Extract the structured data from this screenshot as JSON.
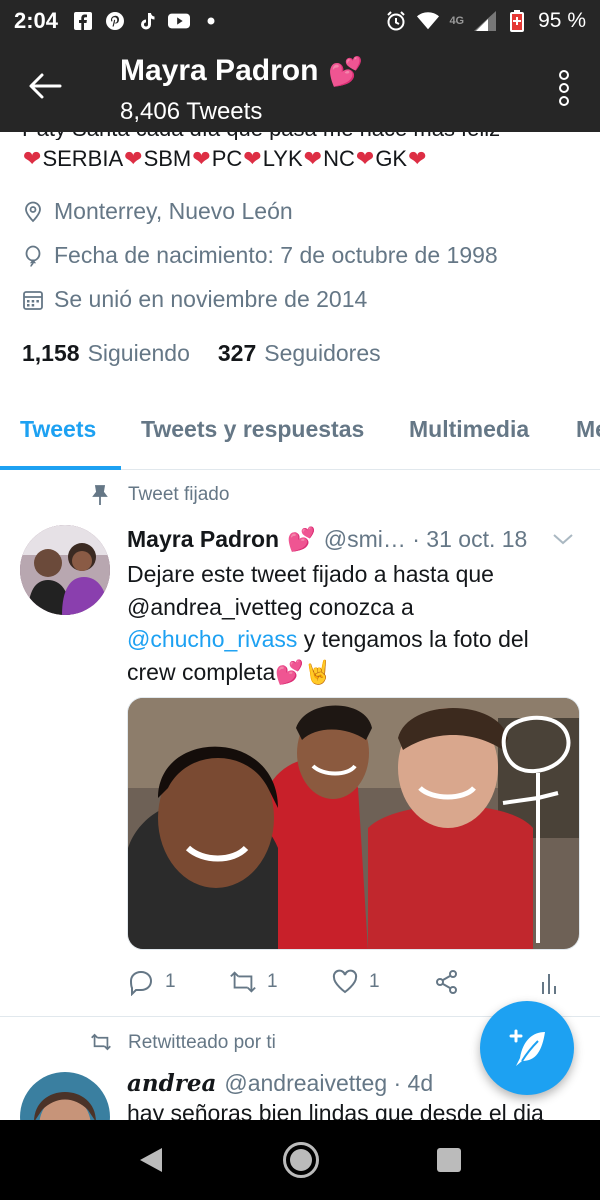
{
  "status_bar": {
    "time": "2:04",
    "battery_percent": "95 %",
    "network": "4G"
  },
  "header": {
    "back_icon": "arrow-left-icon",
    "title": "Mayra Padron",
    "title_emoji": "💕",
    "tweet_count": "8,406 Tweets"
  },
  "profile": {
    "bio_partial": "Paty Santa cada día que pasa me hace más feliz",
    "bio_tags": [
      "SERBIA",
      "SBM",
      "PC",
      "LYK",
      "NC",
      "GK"
    ],
    "location": "Monterrey, Nuevo León",
    "birthdate": "Fecha de nacimiento: 7 de octubre de 1998",
    "joined": "Se unió en noviembre de 2014",
    "following_count": "1,158",
    "following_label": "Siguiendo",
    "followers_count": "327",
    "followers_label": "Seguidores"
  },
  "tabs": [
    {
      "label": "Tweets",
      "active": true
    },
    {
      "label": "Tweets y respuestas",
      "active": false
    },
    {
      "label": "Multimedia",
      "active": false
    },
    {
      "label": "Me",
      "active": false
    }
  ],
  "tweets": [
    {
      "context": "Tweet fijado",
      "name": "Mayra Padron",
      "name_emoji": "💕",
      "handle_date": "@smi… · 31 oct. 18",
      "text_line1": "Dejare este tweet fijado a hasta que",
      "text_line2": "@andrea_ivetteg conozca a",
      "mention": "@chucho_rivass",
      "text_line3_rest": " y tengamos la foto del",
      "text_line4": "crew completa",
      "text_emojis": "💕🤘",
      "replies": "1",
      "retweets": "1",
      "likes": "1"
    },
    {
      "context": "Retwitteado por ti",
      "name": "andrea",
      "handle_date": "@andreaivetteg · 4d",
      "text_partial": "hay señoras bien lindas que desde el dia"
    }
  ],
  "colors": {
    "accent": "#1da1f2",
    "dark_bar": "#262626",
    "secondary_text": "#657786",
    "heart": "#dd2e44"
  }
}
